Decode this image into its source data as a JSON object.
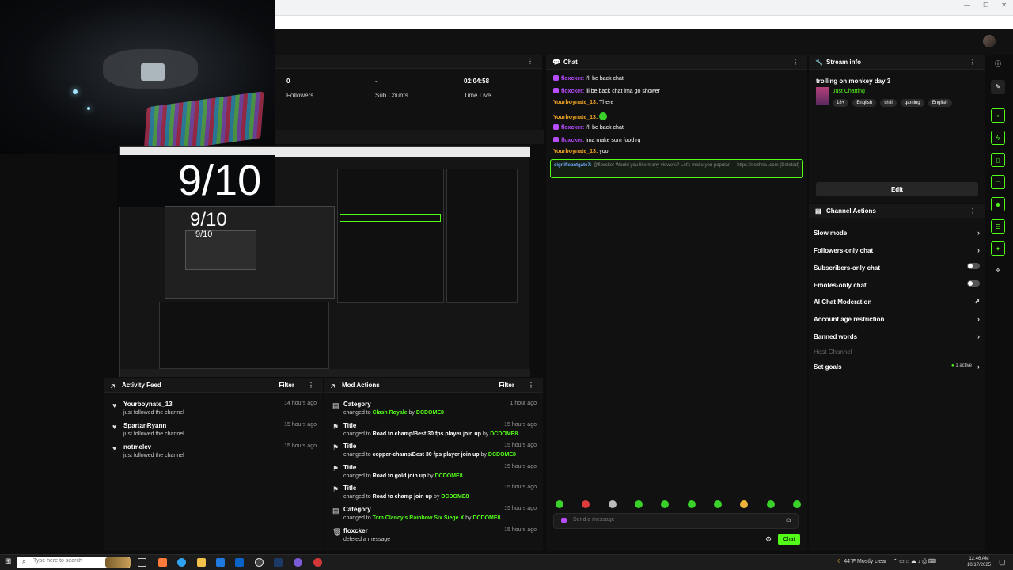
{
  "stats": {
    "followers_value": "0",
    "followers_label": "Followers",
    "subs_value": "-",
    "subs_label": "Sub Counts",
    "time_value": "02:04:58",
    "time_label": "Time Live"
  },
  "preview": {
    "rating_large": "9/10",
    "rating_medium": "9/10",
    "rating_small": "9/10"
  },
  "activity_feed": {
    "title": "Activity Feed",
    "filter_label": "Filter",
    "items": [
      {
        "name": "Yourboynate_13",
        "desc": "just followed the channel",
        "time": "14 hours ago"
      },
      {
        "name": "SpartanRyann",
        "desc": "just followed the channel",
        "time": "15 hours ago"
      },
      {
        "name": "notmelev",
        "desc": "just followed the channel",
        "time": "15 hours ago"
      }
    ]
  },
  "mod_actions": {
    "title": "Mod Actions",
    "filter_label": "Filter",
    "items": [
      {
        "title": "Category",
        "pre": "changed to",
        "value": "Clash Royale",
        "by": "by",
        "user": "DCDOME8",
        "time": "1 hour ago"
      },
      {
        "title": "Title",
        "pre": "changed to",
        "value": "Road to champ/Best 30 fps player join up",
        "by": "by",
        "user": "DCDOME8",
        "time": "15 hours ago"
      },
      {
        "title": "Title",
        "pre": "changed to",
        "value": "copper-champ/Best 30 fps player join up",
        "by": "by",
        "user": "DCDOME8",
        "time": "15 hours ago"
      },
      {
        "title": "Title",
        "pre": "changed to",
        "value": "Road to gold join up",
        "by": "by",
        "user": "DCDOME8",
        "time": "15 hours ago"
      },
      {
        "title": "Title",
        "pre": "changed to",
        "value": "Road to champ join up",
        "by": "by",
        "user": "DCDOME8",
        "time": "15 hours ago"
      },
      {
        "title": "Category",
        "pre": "changed to",
        "value": "Tom Clancy's Rainbow Six Siege X",
        "by": "by",
        "user": "DCDOME8",
        "time": "15 hours ago"
      },
      {
        "title": "floxcker",
        "pre": "deleted a message",
        "value": "",
        "by": "",
        "user": "",
        "time": "15 hours ago"
      }
    ]
  },
  "chat": {
    "title": "Chat",
    "messages": [
      {
        "user": "floxcker:",
        "text": "i'll be back chat",
        "badge": true,
        "color": "#b84cff"
      },
      {
        "user": "floxcker:",
        "text": "ill be back chat ima go shower",
        "badge": true,
        "color": "#b84cff"
      },
      {
        "user": "Yourboynate_13:",
        "text": "There",
        "badge": false,
        "color": "#f5a623"
      },
      {
        "user": "Yourboynate_13:",
        "text": "",
        "badge": false,
        "color": "#f5a623"
      },
      {
        "user": "floxcker:",
        "text": "i'll be back chat",
        "badge": true,
        "color": "#b84cff"
      },
      {
        "user": "floxcker:",
        "text": "ima make sum food rq",
        "badge": true,
        "color": "#b84cff"
      },
      {
        "user": "Yourboynate_13:",
        "text": "yoo",
        "badge": false,
        "color": "#f5a623"
      }
    ],
    "deleted_user": "significantgate7:",
    "deleted_text": "@floxcker Would you like many viewers? Let's make you popular — https://nezhna .com",
    "deleted_tag": "(Deleted)",
    "input_placeholder": "Send a message",
    "send_label": "Chat"
  },
  "stream_info": {
    "title": "Stream info",
    "stream_title": "trolling on monkey day 3",
    "category": "Just Chatting",
    "tags": [
      "18+",
      "English",
      "chill",
      "gaming",
      "English"
    ],
    "edit_label": "Edit"
  },
  "channel_actions": {
    "title": "Channel Actions",
    "slow_mode": "Slow mode",
    "followers_only": "Followers-only chat",
    "subscribers_only": "Subscribers-only chat",
    "emotes_only": "Emotes-only chat",
    "ai_moderation": "AI Chat Moderation",
    "age_restriction": "Account age restriction",
    "banned_words": "Banned words",
    "host_channel": "Host Channel",
    "set_goals": "Set goals",
    "goals_status": "1 active"
  },
  "taskbar": {
    "search_placeholder": "Type here to search",
    "weather": "44°F  Mostly clear",
    "time": "12:46 AM",
    "date": "10/17/2025"
  },
  "colors": {
    "accent": "#53fc18",
    "background": "#0d0d0d",
    "panel": "#111111"
  }
}
